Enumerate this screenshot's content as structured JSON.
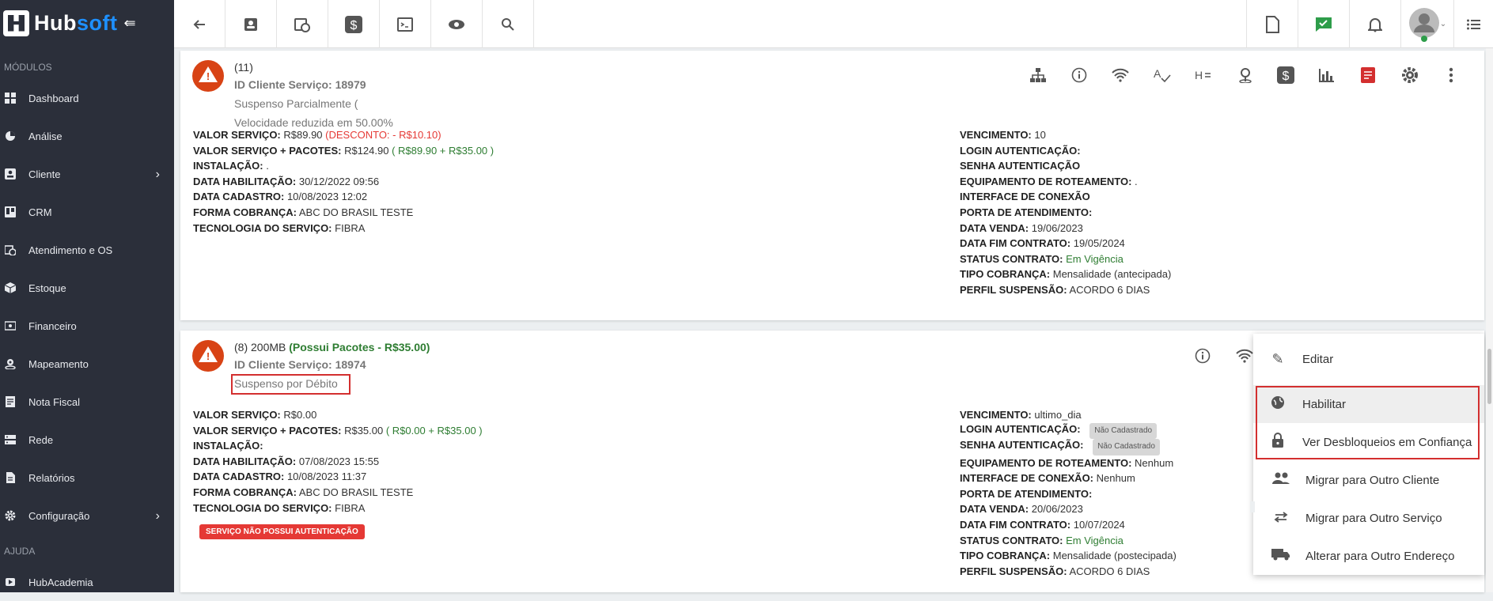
{
  "brand": {
    "name_a": "Hub",
    "name_b": "soft",
    "collapse_glyph": "⇚"
  },
  "sidebar": {
    "section_modules": "MÓDULOS",
    "section_help": "AJUDA",
    "items": [
      {
        "label": "Dashboard",
        "icon": "dashboard-icon"
      },
      {
        "label": "Análise",
        "icon": "pie-chart-icon"
      },
      {
        "label": "Cliente",
        "icon": "client-card-icon",
        "chevron": "›"
      },
      {
        "label": "CRM",
        "icon": "kanban-icon"
      },
      {
        "label": "Atendimento e OS",
        "icon": "calendar-clock-icon"
      },
      {
        "label": "Estoque",
        "icon": "box-icon"
      },
      {
        "label": "Financeiro",
        "icon": "money-icon"
      },
      {
        "label": "Mapeamento",
        "icon": "map-pin-icon"
      },
      {
        "label": "Nota Fiscal",
        "icon": "invoice-icon"
      },
      {
        "label": "Rede",
        "icon": "server-icon"
      },
      {
        "label": "Relatórios",
        "icon": "report-icon"
      },
      {
        "label": "Configuração",
        "icon": "gear-icon",
        "chevron": "›"
      }
    ],
    "help_items": [
      {
        "label": "HubAcademia",
        "icon": "play-icon"
      }
    ]
  },
  "topbar": {
    "left_icons": [
      "back-arrow-icon",
      "contact-card-icon",
      "calendar-clock-icon",
      "dollar-icon",
      "terminal-icon",
      "eye-icon",
      "search-icon"
    ],
    "right_icons": [
      "pdf-icon",
      "check-message-icon",
      "bell-icon",
      "avatar",
      "list-icon"
    ]
  },
  "service1": {
    "title": "(11)",
    "id_label": "ID Cliente Serviço: 18979",
    "status": "Suspenso Parcialmente (",
    "status2": "Velocidade reduzida em 50.00%",
    "left": [
      {
        "k": "VALOR SERVIÇO:",
        "v": "R$89.90",
        "extra": "(DESCONTO: - R$10.10)"
      },
      {
        "k": "VALOR SERVIÇO + PACOTES:",
        "v": "R$124.90",
        "extra": "( R$89.90 + R$35.00 )"
      },
      {
        "k": "INSTALAÇÃO:",
        "v": "."
      },
      {
        "k": "DATA HABILITAÇÃO:",
        "v": "30/12/2022 09:56"
      },
      {
        "k": "DATA CADASTRO:",
        "v": "10/08/2023 12:02"
      },
      {
        "k": "FORMA COBRANÇA:",
        "v": "ABC DO BRASIL TESTE"
      },
      {
        "k": "TECNOLOGIA DO SERVIÇO:",
        "v": "FIBRA"
      }
    ],
    "right": [
      {
        "k": "VENCIMENTO:",
        "v": "10"
      },
      {
        "k": "LOGIN AUTENTICAÇÃO:",
        "v": ""
      },
      {
        "k": "SENHA AUTENTICAÇÃO",
        "v": ""
      },
      {
        "k": "EQUIPAMENTO DE ROTEAMENTO:",
        "v": "."
      },
      {
        "k": "INTERFACE DE CONEXÃO",
        "v": ""
      },
      {
        "k": "PORTA DE ATENDIMENTO:",
        "v": ""
      },
      {
        "k": "DATA VENDA:",
        "v": "19/06/2023"
      },
      {
        "k": "DATA FIM CONTRATO:",
        "v": "19/05/2024"
      },
      {
        "k": "STATUS CONTRATO:",
        "v": "Em Vigência"
      },
      {
        "k": "TIPO COBRANÇA:",
        "v": "Mensalidade (antecipada)"
      },
      {
        "k": "PERFIL SUSPENSÃO:",
        "v": "ACORDO 6 DIAS"
      }
    ]
  },
  "service2": {
    "title": "(8) 200MB",
    "title_extra": "(Possui Pacotes - R$35.00)",
    "id_label": "ID Cliente Serviço: 18974",
    "status": "Suspenso por Débito",
    "left": [
      {
        "k": "VALOR SERVIÇO:",
        "v": "R$0.00"
      },
      {
        "k": "VALOR SERVIÇO + PACOTES:",
        "v": "R$35.00",
        "extra": "( R$0.00 + R$35.00 )"
      },
      {
        "k": "INSTALAÇÃO:",
        "v": ""
      },
      {
        "k": "DATA HABILITAÇÃO:",
        "v": "07/08/2023 15:55"
      },
      {
        "k": "DATA CADASTRO:",
        "v": "10/08/2023 11:37"
      },
      {
        "k": "FORMA COBRANÇA:",
        "v": "ABC DO BRASIL TESTE"
      },
      {
        "k": "TECNOLOGIA DO SERVIÇO:",
        "v": "FIBRA"
      }
    ],
    "auth_badge": "SERVIÇO NÃO POSSUI AUTENTICAÇÃO",
    "right": [
      {
        "k": "VENCIMENTO:",
        "v": "ultimo_dia"
      },
      {
        "k": "LOGIN AUTENTICAÇÃO:",
        "v": "",
        "badge": "Não Cadastrado"
      },
      {
        "k": "SENHA AUTENTICAÇÃO:",
        "v": "",
        "badge": "Não Cadastrado"
      },
      {
        "k": "EQUIPAMENTO DE ROTEAMENTO:",
        "v": "Nenhum"
      },
      {
        "k": "INTERFACE DE CONEXÃO:",
        "v": "Nenhum"
      },
      {
        "k": "PORTA DE ATENDIMENTO:",
        "v": ""
      },
      {
        "k": "DATA VENDA:",
        "v": "20/06/2023"
      },
      {
        "k": "DATA FIM CONTRATO:",
        "v": "10/07/2024"
      },
      {
        "k": "STATUS CONTRATO:",
        "v": "Em Vigência"
      },
      {
        "k": "TIPO COBRANÇA:",
        "v": "Mensalidade (postecipada)"
      },
      {
        "k": "PERFIL SUSPENSÃO:",
        "v": "ACORDO 6 DIAS"
      }
    ]
  },
  "menu": {
    "items": [
      {
        "label": "Editar",
        "icon": "pencil-icon"
      },
      {
        "label": "Habilitar",
        "icon": "globe-icon"
      },
      {
        "label": "Ver Desbloqueios em Confiança",
        "icon": "lock-icon"
      },
      {
        "label": "Migrar para Outro Cliente",
        "icon": "people-icon"
      },
      {
        "label": "Migrar para Outro Serviço",
        "icon": "swap-arrows-icon"
      },
      {
        "label": "Alterar para Outro Endereço",
        "icon": "truck-icon"
      }
    ]
  },
  "colors": {
    "sidebar": "#2b2f3a",
    "accent": "#1e90ff",
    "warning": "#d84315",
    "highlight": "#d32f2f",
    "ok": "#2e7d32"
  }
}
